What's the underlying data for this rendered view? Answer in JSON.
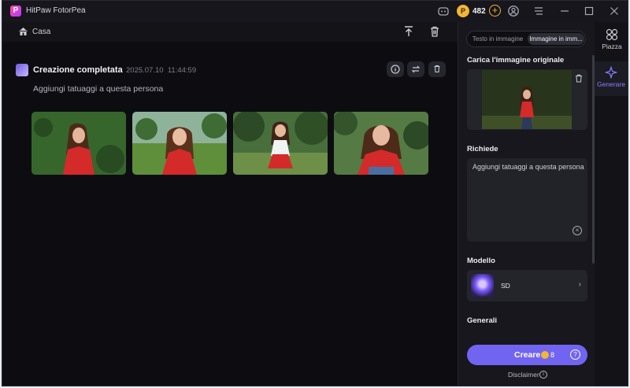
{
  "titlebar": {
    "app_title": "HitPaw FotorPea",
    "logo_letter": "P",
    "coins": "482",
    "coin_symbol": "P"
  },
  "topbar": {
    "breadcrumb": "Casa"
  },
  "result": {
    "title": "Creazione completata",
    "date": "2025.07.10",
    "time": "11:44:59",
    "prompt": "Aggiungi tatuaggi a questa persona"
  },
  "panel": {
    "tabs": [
      "Testo in immagine",
      "Immagine in imm..."
    ],
    "upload_label": "Carica l'immagine originale",
    "prompt_label": "Richiede",
    "prompt_value": "Aggiungi tatuaggi a questa persona",
    "model_label": "Modello",
    "model_name": "SD",
    "general_label": "Generali",
    "create_label": "Creare",
    "create_cost": "8",
    "disclaimer": "Disclaimer"
  },
  "nav": {
    "items": [
      {
        "label": "Piazza",
        "icon": "grid-icon"
      },
      {
        "label": "Generare",
        "icon": "sparkle-icon"
      }
    ]
  },
  "colors": {
    "accent": "#7164f0",
    "coin": "#f2b535",
    "shirt_red": "#d42a2a",
    "background": "#0d0d11"
  }
}
